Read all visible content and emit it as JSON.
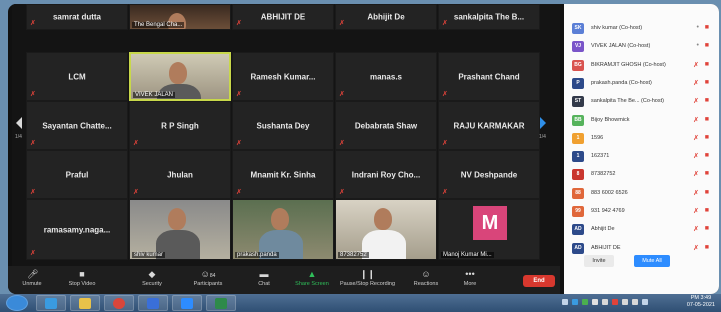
{
  "gallery": {
    "page_left": "1/4",
    "page_right": "1/4",
    "tiles": [
      {
        "name": "samrat dutta"
      },
      {
        "name": "The Bengal Cha...",
        "video": true
      },
      {
        "name": "ABHIJIT DE"
      },
      {
        "name": "Abhijit De"
      },
      {
        "name": "sankalpita The B..."
      },
      {
        "name": "LCM"
      },
      {
        "name": "VIVEK JALAN",
        "video": true
      },
      {
        "name": "Ramesh Kumar..."
      },
      {
        "name": "manas.s"
      },
      {
        "name": "Prashant Chand"
      },
      {
        "name": "Sayantan Chatte..."
      },
      {
        "name": "R P Singh"
      },
      {
        "name": "Sushanta Dey"
      },
      {
        "name": "Debabrata Shaw"
      },
      {
        "name": "RAJU KARMAKAR"
      },
      {
        "name": "Praful"
      },
      {
        "name": "Jhulan"
      },
      {
        "name": "Mnamit Kr. Sinha"
      },
      {
        "name": "Indrani Roy Cho..."
      },
      {
        "name": "NV Deshpande"
      },
      {
        "name": "ramasamy.naga..."
      },
      {
        "name": "shiv kumar",
        "video": true
      },
      {
        "name": "prakash.panda",
        "video": true
      },
      {
        "name": "87382752",
        "video": true
      },
      {
        "name": "Manoj Kumar Mi...",
        "avatar": "M"
      }
    ]
  },
  "toolbar": {
    "unmute": "Unmute",
    "stop_video": "Stop Video",
    "security": "Security",
    "participants": "Participants",
    "participants_count": "84",
    "chat": "Chat",
    "share_screen": "Share Screen",
    "pause_recording": "Pause/Stop Recording",
    "reactions": "Reactions",
    "more": "More",
    "end": "End"
  },
  "panel": {
    "participants": [
      {
        "initials": "SK",
        "name": "shiv kumar (Co-host)",
        "color": "#5b7fd6",
        "muted": false
      },
      {
        "initials": "VJ",
        "name": "VIVEK JALAN (Co-host)",
        "color": "#7a55c9",
        "muted": false
      },
      {
        "initials": "BG",
        "name": "BIKRAMJIT GHOSH (Co-host)",
        "color": "#d9534f",
        "muted": true
      },
      {
        "initials": "P",
        "name": "prakash.panda (Co-host)",
        "color": "#2d4a8a",
        "muted": true
      },
      {
        "initials": "ST",
        "name": "sankalpita The Be... (Co-host)",
        "color": "#333a4a",
        "muted": true
      },
      {
        "initials": "BB",
        "name": "Bijoy Bhowmick",
        "color": "#56b35c",
        "muted": true
      },
      {
        "initials": "1",
        "name": "1596",
        "color": "#f0a030",
        "muted": true
      },
      {
        "initials": "1",
        "name": "162371",
        "color": "#2d4a8a",
        "muted": true
      },
      {
        "initials": "8",
        "name": "87382752",
        "color": "#c9362e",
        "muted": true
      },
      {
        "initials": "88",
        "name": "883 6002 6526",
        "color": "#e0673a",
        "muted": true
      },
      {
        "initials": "99",
        "name": "931 942 4769",
        "color": "#e0673a",
        "muted": true
      },
      {
        "initials": "AD",
        "name": "Abhijit De",
        "color": "#2d4a8a",
        "muted": true
      },
      {
        "initials": "AD",
        "name": "ABHIJIT DE",
        "color": "#2d4a8a",
        "muted": true
      }
    ],
    "invite": "Invite",
    "mute_all": "Mute All"
  },
  "taskbar": {
    "time": "PM 3:49",
    "date": "07-05-2021"
  }
}
